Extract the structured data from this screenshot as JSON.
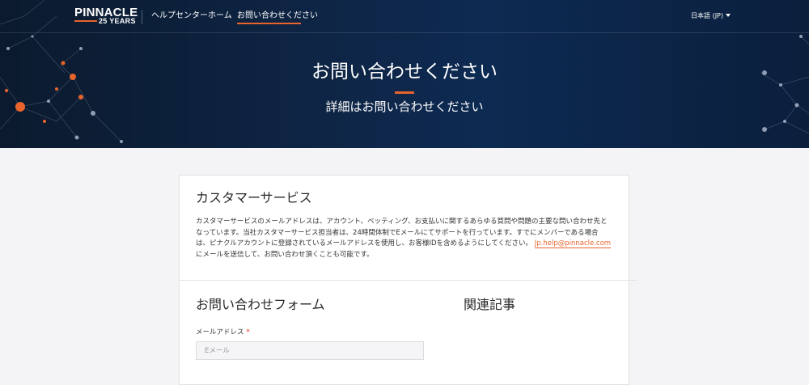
{
  "header": {
    "logo_text": "PINNACLE",
    "logo_sub": "25 YEARS",
    "nav": [
      {
        "label": "ヘルプセンターホーム"
      },
      {
        "label": "お問い合わせください"
      }
    ],
    "language": "日本語 (JP)"
  },
  "hero": {
    "title": "お問い合わせください",
    "subtitle": "詳細はお問い合わせください"
  },
  "customer_service": {
    "title": "カスタマーサービス",
    "body_lines": [
      "カスタマーサービスのメールアドレスは、アカウント、ベッティング、お支払いに関するあらゆる質問や問題の主要な問い合わせ先と",
      "なっています。当社カスタマーサービス担当者は、24時間体制でEメールにてサポートを行っています。すでにメンバーである場合",
      "は、ピナクルアカウントに登録されているメールアドレスを使用し、お客様IDを含めるようにしてください。"
    ],
    "email": "Jp.help@pinnacle.com",
    "body_tail": "にメールを送信して、お問い合わせ頂くことも可能です。"
  },
  "contact_form": {
    "title": "お問い合わせフォーム",
    "email_label": "メールアドレス",
    "required_mark": "*",
    "email_placeholder": "Eメール",
    "email_value": ""
  },
  "related": {
    "title": "関連記事"
  },
  "colors": {
    "accent": "#e8642c",
    "hero_bg": "#0e2545",
    "page_bg": "#f4f4f6"
  }
}
